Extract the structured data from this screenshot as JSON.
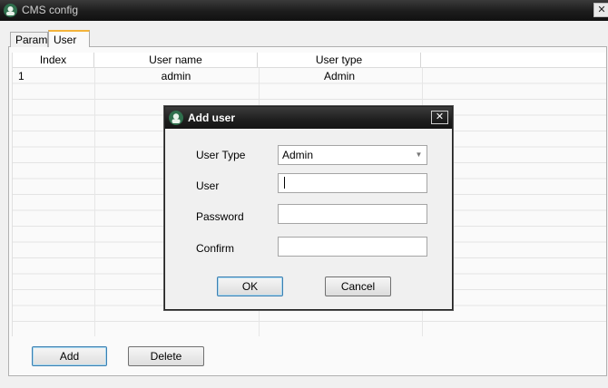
{
  "window": {
    "title": "CMS config",
    "close_glyph": "✕"
  },
  "tabs": [
    {
      "label": "Param",
      "active": false
    },
    {
      "label": "User",
      "active": true
    }
  ],
  "table": {
    "columns": [
      "Index",
      "User name",
      "User type"
    ],
    "rows": [
      {
        "index": "1",
        "user_name": "admin",
        "user_type": "Admin"
      }
    ]
  },
  "buttons": {
    "add": "Add",
    "delete": "Delete"
  },
  "dialog": {
    "title": "Add user",
    "close_glyph": "✕",
    "fields": {
      "user_type": {
        "label": "User Type",
        "value": "Admin"
      },
      "user": {
        "label": "User",
        "value": ""
      },
      "password": {
        "label": "Password",
        "value": ""
      },
      "confirm": {
        "label": "Confirm",
        "value": ""
      }
    },
    "ok": "OK",
    "cancel": "Cancel"
  },
  "colors": {
    "tab_accent": "#f3b33b",
    "titlebar": "#1c1c1c",
    "focus_border": "#3c7fb1"
  },
  "icons": [
    "app-icon",
    "close-icon",
    "dropdown-arrow-icon"
  ]
}
